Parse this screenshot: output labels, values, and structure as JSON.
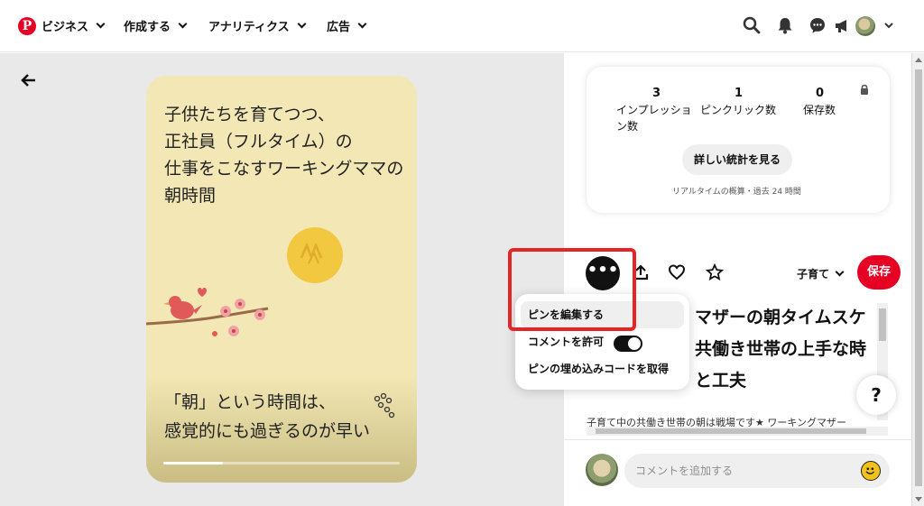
{
  "topbar": {
    "logo_letter": "P",
    "nav": [
      {
        "label": "ビジネス"
      },
      {
        "label": "作成する"
      },
      {
        "label": "アナリティクス"
      },
      {
        "label": "広告"
      }
    ],
    "icons": [
      "search-icon",
      "bell-icon",
      "message-icon",
      "megaphone-icon",
      "avatar",
      "chevron-down-icon"
    ]
  },
  "pin": {
    "card_title_lines": [
      "子供たちを育てつつ、",
      "正社員（フルタイム）の",
      "仕事をこなすワーキングママの",
      "朝時間"
    ],
    "card_bottom_lines": [
      "「朝」という時間は、",
      "感覚的にも過ぎるのが早い"
    ],
    "progress": 0.25
  },
  "stats": {
    "impressions_value": "3",
    "impressions_label_lines": [
      "インプレッショ",
      "ン数"
    ],
    "clicks_value": "1",
    "clicks_label": "ピンクリック数",
    "saves_value": "0",
    "saves_label": "保存数",
    "details_button": "詳しい統計を見る",
    "note": "リアルタイムの概算・過去 24 時間"
  },
  "actions": {
    "more_label": "•••",
    "board_label": "子育て",
    "save_label": "保存"
  },
  "menu": {
    "edit_pin": "ピンを編集する",
    "allow_comments": "コメントを許可",
    "embed_code": "ピンの埋め込みコードを取得",
    "comments_enabled": true
  },
  "detail": {
    "title_lines": [
      "マザーの朝タイムスケ",
      "共働き世帯の上手な時",
      "と工夫"
    ],
    "description": "子育て中の共働き世帯の朝は戦場です★ ワーキングマザー"
  },
  "comment": {
    "placeholder": "コメントを追加する"
  },
  "help_label": "?",
  "colors": {
    "brand_red": "#e60023",
    "highlight_red": "#e52424",
    "card_bg": "#f3e8b5"
  }
}
